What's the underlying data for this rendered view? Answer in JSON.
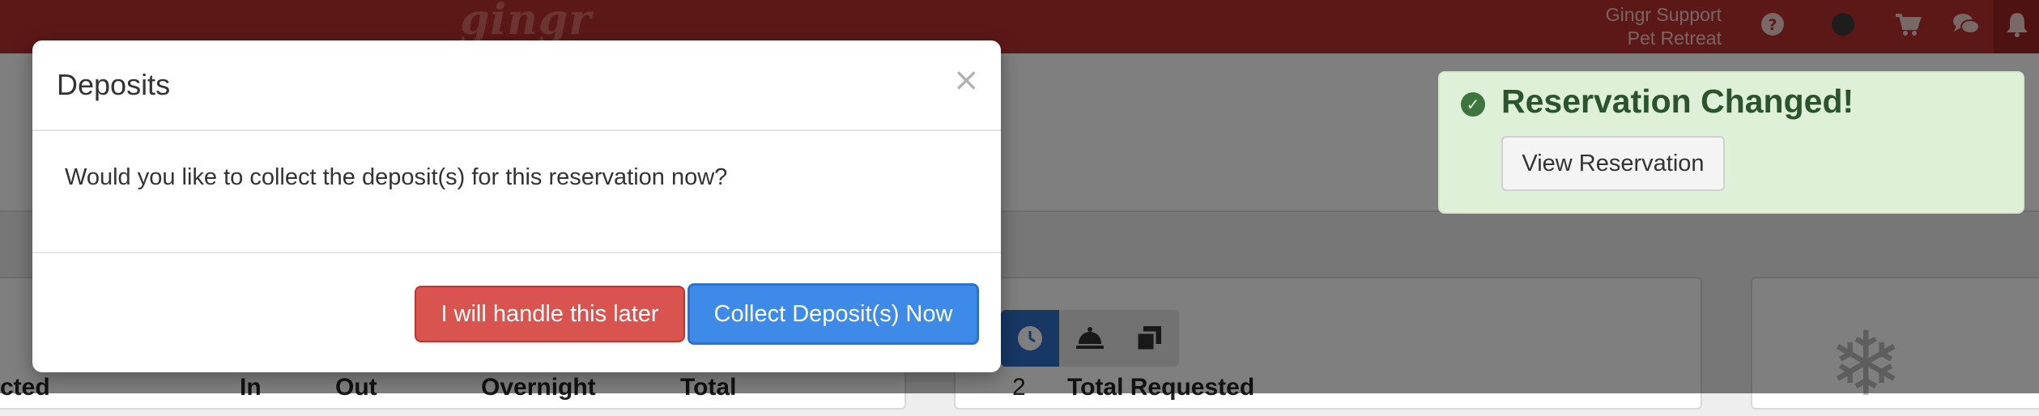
{
  "topbar": {
    "logo_text": "gingr",
    "user_name": "Gingr Support",
    "location": "Pet Retreat",
    "icons": [
      "help-icon",
      "status-dot-icon",
      "cart-icon",
      "chat-icon",
      "bell-icon"
    ]
  },
  "background": {
    "table_headers": [
      "cted",
      "In",
      "Out",
      "Overnight",
      "Total"
    ],
    "count_value": "2",
    "requested_label": "Total Requested",
    "toolbar_icons": [
      "clock-icon",
      "service-bell-icon",
      "copy-icon"
    ],
    "snowflake_icon": "snowflake-icon"
  },
  "modal": {
    "title": "Deposits",
    "close_label": "×",
    "body": "Would you like to collect the deposit(s) for this reservation now?",
    "later_button": "I will handle this later",
    "collect_button": "Collect Deposit(s) Now"
  },
  "toast": {
    "title": "Reservation Changed!",
    "button": "View Reservation",
    "icon": "check-circle-icon"
  },
  "colors": {
    "topbar": "#b8312f",
    "primary": "#3e8ae8",
    "danger": "#d9534f",
    "success_bg": "#dff0d8",
    "success_text": "#2b542c"
  }
}
